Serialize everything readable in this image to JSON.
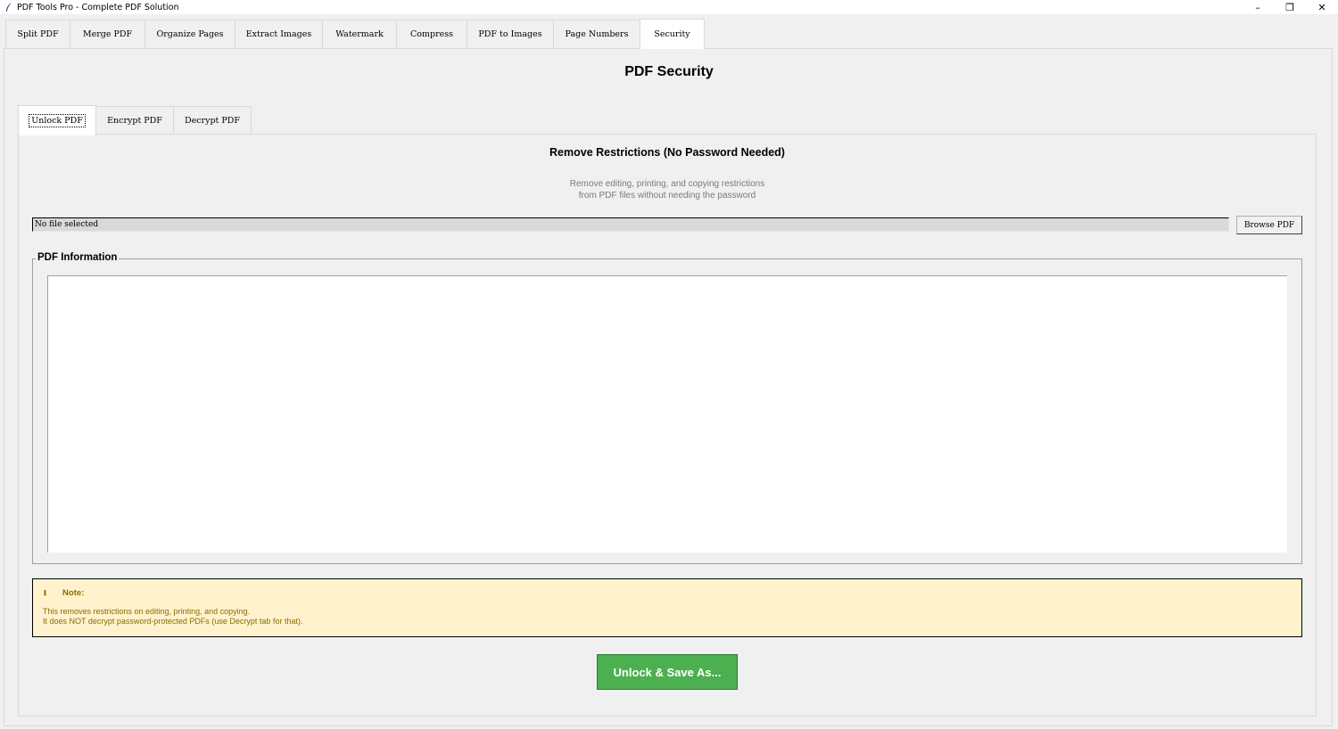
{
  "window": {
    "title": "PDF Tools Pro - Complete PDF Solution",
    "controls": {
      "minimize": "–",
      "restore": "❐",
      "close": "✕"
    }
  },
  "main_tabs": [
    {
      "label": "Split PDF"
    },
    {
      "label": "Merge PDF"
    },
    {
      "label": "Organize Pages"
    },
    {
      "label": "Extract Images"
    },
    {
      "label": "Watermark"
    },
    {
      "label": "Compress"
    },
    {
      "label": "PDF to Images"
    },
    {
      "label": "Page Numbers"
    },
    {
      "label": "Security"
    }
  ],
  "active_main_tab": "Security",
  "page_title": "PDF Security",
  "sub_tabs": [
    {
      "label": "Unlock PDF"
    },
    {
      "label": "Encrypt PDF"
    },
    {
      "label": "Decrypt PDF"
    }
  ],
  "active_sub_tab": "Unlock PDF",
  "unlock": {
    "section_title": "Remove Restrictions (No Password Needed)",
    "description_line1": "Remove editing, printing, and copying restrictions",
    "description_line2": "from PDF files without needing the password",
    "file_field_value": "No file selected",
    "browse_label": "Browse PDF",
    "info_group_label": "PDF Information",
    "info_text": "",
    "note": {
      "icon": "ℹ",
      "heading": "Note:",
      "line1": "This removes restrictions on editing, printing, and copying.",
      "line2": "It does NOT decrypt password-protected PDFs (use Decrypt tab for that)."
    },
    "action_label": "Unlock & Save As..."
  },
  "colors": {
    "accent_green": "#4caf50",
    "note_bg": "#fff2cc",
    "note_text": "#8a6d00",
    "description_text": "#7a7a7a"
  }
}
